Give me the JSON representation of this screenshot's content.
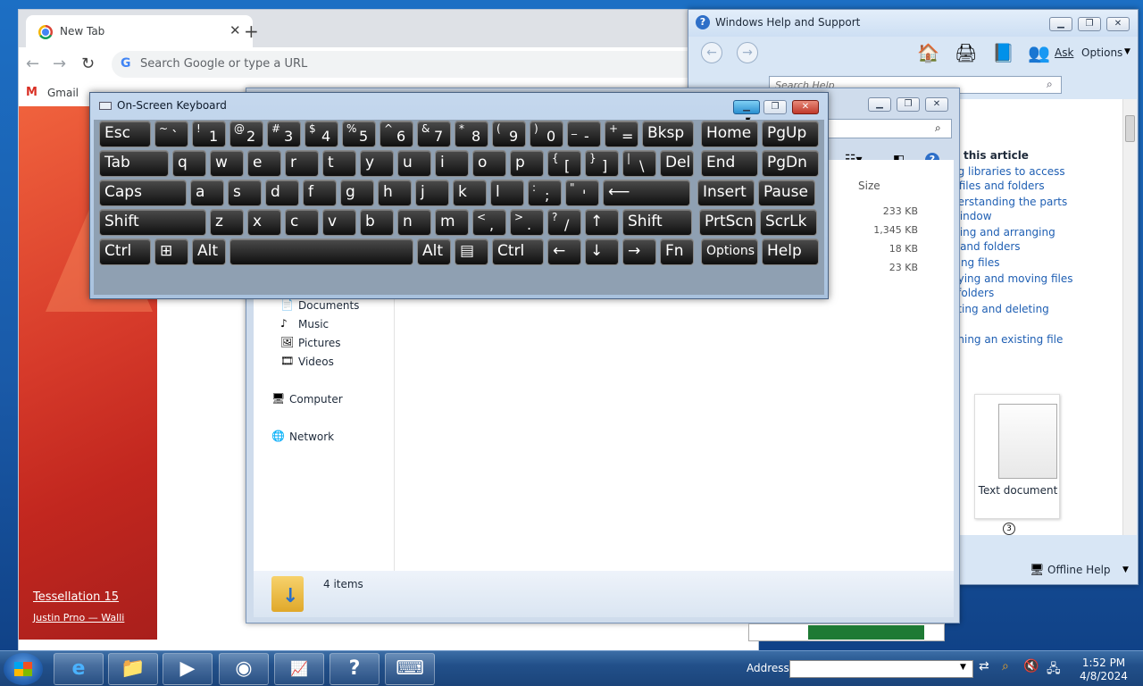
{
  "chrome": {
    "tab_title": "New Tab",
    "close_glyph": "✕",
    "new_tab_glyph": "+",
    "back_glyph": "←",
    "forward_glyph": "→",
    "reload_glyph": "↻",
    "omnibox_placeholder": "Search Google or type a URL",
    "bookmark_gmail": "Gmail",
    "wallpaper_title": "Tessellation 15",
    "wallpaper_author": "Justin Prno — Walli"
  },
  "help": {
    "title": "Windows Help and Support",
    "ask": "Ask",
    "options": "Options",
    "search_placeholder": "Search Help",
    "section_title": "this article",
    "links": [
      "ng libraries to access",
      "r files and folders",
      "derstanding the parts",
      "window",
      "wing and arranging",
      "s and folders",
      "ding files",
      "pying and moving files",
      "l folders",
      "ating and deleting",
      "s",
      "ening an existing file"
    ],
    "doc_label": "Text document",
    "callout": "3",
    "offline": "Offline Help"
  },
  "explorer": {
    "col_size": "Size",
    "sizes": [
      "233 KB",
      "1,345 KB",
      "18 KB",
      "23 KB"
    ],
    "nav": [
      "Documents",
      "Music",
      "Pictures",
      "Videos",
      "Computer",
      "Network"
    ],
    "status": "4 items"
  },
  "osk": {
    "title": "On-Screen Keyboard",
    "rows": [
      [
        [
          "Esc",
          ""
        ],
        [
          "`",
          "~"
        ],
        [
          "1",
          "!"
        ],
        [
          "2",
          "@"
        ],
        [
          "3",
          "#"
        ],
        [
          "4",
          "$"
        ],
        [
          "5",
          "%"
        ],
        [
          "6",
          "^"
        ],
        [
          "7",
          "&"
        ],
        [
          "8",
          "*"
        ],
        [
          "9",
          "("
        ],
        [
          "0",
          ")"
        ],
        [
          "-",
          "_"
        ],
        [
          "=",
          "+"
        ],
        [
          "Bksp",
          ""
        ],
        [
          "Home",
          ""
        ],
        [
          "PgUp",
          ""
        ]
      ],
      [
        [
          "Tab",
          ""
        ],
        [
          "q",
          ""
        ],
        [
          "w",
          ""
        ],
        [
          "e",
          ""
        ],
        [
          "r",
          ""
        ],
        [
          "t",
          ""
        ],
        [
          "y",
          ""
        ],
        [
          "u",
          ""
        ],
        [
          "i",
          ""
        ],
        [
          "o",
          ""
        ],
        [
          "p",
          ""
        ],
        [
          "[",
          "{"
        ],
        [
          "]",
          "}"
        ],
        [
          "\\",
          "|"
        ],
        [
          "Del",
          ""
        ],
        [
          "End",
          ""
        ],
        [
          "PgDn",
          ""
        ]
      ],
      [
        [
          "Caps",
          ""
        ],
        [
          "a",
          ""
        ],
        [
          "s",
          ""
        ],
        [
          "d",
          ""
        ],
        [
          "f",
          ""
        ],
        [
          "g",
          ""
        ],
        [
          "h",
          ""
        ],
        [
          "j",
          ""
        ],
        [
          "k",
          ""
        ],
        [
          "l",
          ""
        ],
        [
          ";",
          ":"
        ],
        [
          "'",
          "\""
        ],
        [
          "⟵",
          ""
        ],
        [
          "Insert",
          ""
        ],
        [
          "Pause",
          ""
        ]
      ],
      [
        [
          "Shift",
          ""
        ],
        [
          "z",
          ""
        ],
        [
          "x",
          ""
        ],
        [
          "c",
          ""
        ],
        [
          "v",
          ""
        ],
        [
          "b",
          ""
        ],
        [
          "n",
          ""
        ],
        [
          "m",
          ""
        ],
        [
          ",",
          "<"
        ],
        [
          ".",
          ">"
        ],
        [
          "/",
          "?"
        ],
        [
          "↑",
          ""
        ],
        [
          "Shift",
          ""
        ],
        [
          "PrtScn",
          ""
        ],
        [
          "ScrLk",
          ""
        ]
      ],
      [
        [
          "Ctrl",
          ""
        ],
        [
          "⊞",
          ""
        ],
        [
          "Alt",
          ""
        ],
        [
          "",
          ""
        ],
        [
          "Alt",
          ""
        ],
        [
          "▤",
          ""
        ],
        [
          "Ctrl",
          ""
        ],
        [
          "←",
          ""
        ],
        [
          "↓",
          ""
        ],
        [
          "→",
          ""
        ],
        [
          "Fn",
          ""
        ],
        [
          "Options",
          ""
        ],
        [
          "Help",
          ""
        ]
      ]
    ]
  },
  "taskbar": {
    "address_label": "Address",
    "time": "1:52 PM",
    "date": "4/8/2024"
  }
}
